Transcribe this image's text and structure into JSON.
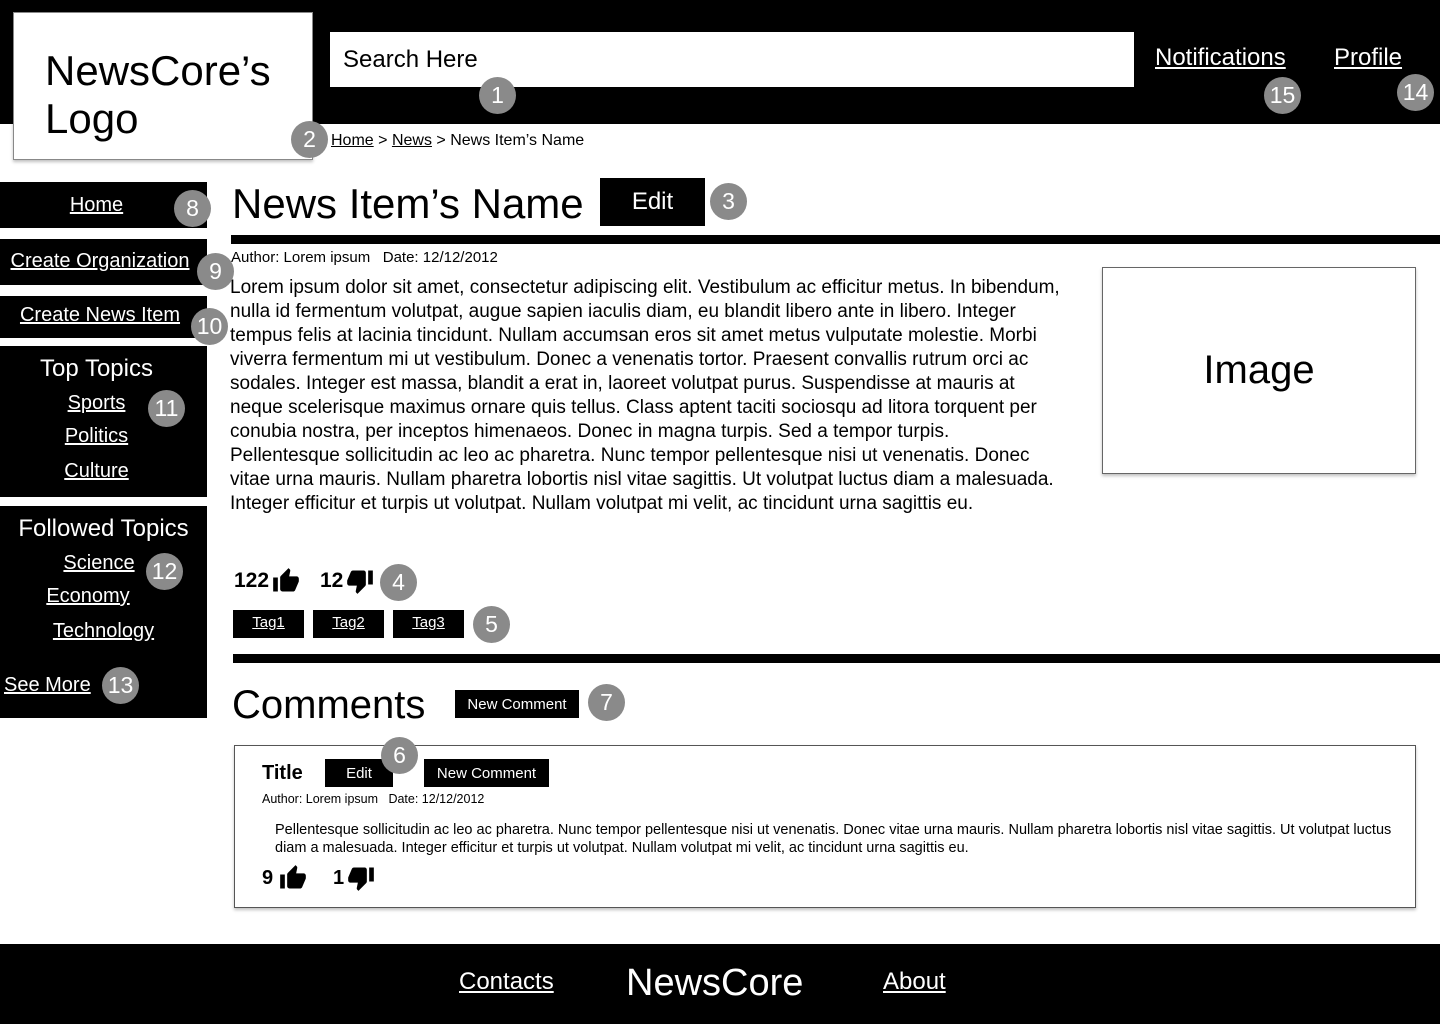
{
  "header": {
    "logo_text": "NewsCore’s Logo",
    "search_placeholder": "Search Here",
    "notifications_label": "Notifications",
    "profile_label": "Profile"
  },
  "breadcrumb": {
    "home": "Home",
    "news": "News",
    "separator": ">",
    "current": "News Item’s Name"
  },
  "sidebar": {
    "home": "Home",
    "create_organization": "Create Organization",
    "create_news_item": "Create News Item",
    "top_topics": {
      "heading": "Top Topics",
      "items": [
        "Sports",
        "Politics",
        "Culture"
      ]
    },
    "followed_topics": {
      "heading": "Followed Topics",
      "items": [
        "Science",
        "Economy",
        "Technology"
      ]
    },
    "see_more": "See More"
  },
  "article": {
    "title": "News Item’s Name",
    "edit_label": "Edit",
    "author": "Author: Lorem ipsum",
    "date": "Date: 12/12/2012",
    "paragraph1": "Lorem ipsum dolor sit amet, consectetur adipiscing elit. Vestibulum ac efficitur metus. In bibendum, nulla id fermentum volutpat, augue sapien iaculis diam, eu blandit libero ante in libero. Integer tempus felis at lacinia tincidunt. Nullam accumsan eros sit amet metus vulputate molestie. Morbi viverra fermentum mi ut vestibulum. Donec a venenatis tortor. Praesent convallis rutrum orci ac sodales. Integer est massa, blandit a erat in, laoreet volutpat purus. Suspendisse at mauris at neque scelerisque maximus ornare quis tellus. Class aptent taciti sociosqu ad litora torquent per conubia nostra, per inceptos himenaeos. Donec in magna turpis. Sed a tempor turpis.",
    "paragraph2": "Pellentesque sollicitudin ac leo ac pharetra. Nunc tempor pellentesque nisi ut venenatis. Donec vitae urna mauris. Nullam pharetra lobortis nisl vitae sagittis. Ut volutpat luctus diam a malesuada. Integer efficitur et turpis ut volutpat. Nullam volutpat mi velit, ac tincidunt urna sagittis eu.",
    "image_label": "Image",
    "likes": "122",
    "dislikes": "12",
    "tags": [
      "Tag1",
      "Tag2",
      "Tag3"
    ]
  },
  "comments": {
    "heading": "Comments",
    "new_comment_label": "New Comment",
    "items": [
      {
        "title": "Title",
        "edit_label": "Edit",
        "reply_label": "New Comment",
        "author": "Author: Lorem ipsum",
        "date": "Date: 12/12/2012",
        "text": "Pellentesque sollicitudin ac leo ac pharetra. Nunc tempor pellentesque nisi ut venenatis. Donec vitae urna mauris. Nullam pharetra lobortis nisl vitae sagittis. Ut volutpat luctus diam a malesuada. Integer efficitur et turpis ut volutpat. Nullam volutpat mi velit, ac tincidunt urna sagittis eu.",
        "likes": "9",
        "dislikes": "1"
      }
    ]
  },
  "footer": {
    "contacts": "Contacts",
    "brand": "NewsCore",
    "about": "About"
  },
  "markers": {
    "search": "1",
    "breadcrumb": "2",
    "edit": "3",
    "votes": "4",
    "tags": "5",
    "comment": "6",
    "new_comment": "7",
    "home": "8",
    "create_org": "9",
    "create_news": "10",
    "top_topics": "11",
    "followed_topics": "12",
    "see_more": "13",
    "profile": "14",
    "notifications": "15"
  },
  "icons": {
    "like": "thumbs-up-icon",
    "dislike": "thumbs-down-icon"
  }
}
